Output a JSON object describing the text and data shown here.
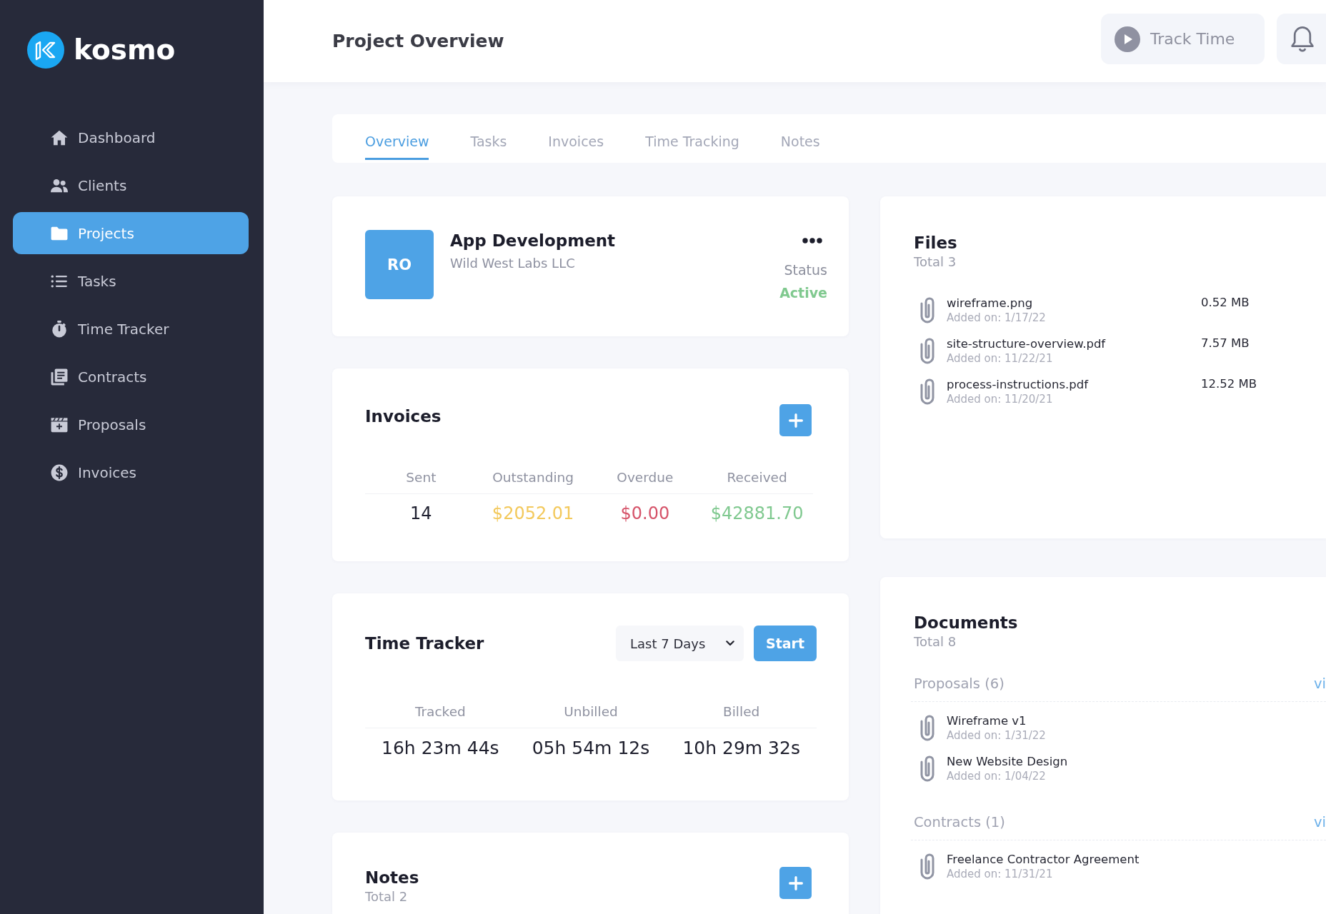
{
  "sidebar": {
    "brand": "kosmo",
    "items": [
      {
        "label": "Dashboard",
        "selected": false
      },
      {
        "label": "Clients",
        "selected": false
      },
      {
        "label": "Projects",
        "selected": true
      },
      {
        "label": "Tasks",
        "selected": false
      },
      {
        "label": "Time Tracker",
        "selected": false
      },
      {
        "label": "Contracts",
        "selected": false
      },
      {
        "label": "Proposals",
        "selected": false
      },
      {
        "label": "Invoices",
        "selected": false
      }
    ]
  },
  "header": {
    "title": "Project Overview",
    "track_button": "Track Time"
  },
  "tabs": [
    {
      "label": "Overview",
      "selected": true
    },
    {
      "label": "Tasks",
      "selected": false
    },
    {
      "label": "Invoices",
      "selected": false
    },
    {
      "label": "Time Tracking",
      "selected": false
    },
    {
      "label": "Notes",
      "selected": false
    }
  ],
  "project": {
    "initials": "RO",
    "name": "App Development",
    "client": "Wild West Labs LLC",
    "status_label": "Status",
    "status": "Active"
  },
  "invoices": {
    "title": "Invoices",
    "stats": [
      {
        "label": "Sent",
        "value": "14",
        "color": "#1f2030"
      },
      {
        "label": "Outstanding",
        "value": "$2052.01",
        "color": "#f3c95c"
      },
      {
        "label": "Overdue",
        "value": "$0.00",
        "color": "#d6546a"
      },
      {
        "label": "Received",
        "value": "$42881.70",
        "color": "#80c990"
      }
    ]
  },
  "time_tracker": {
    "title": "Time Tracker",
    "range": "Last 7 Days",
    "start_button": "Start",
    "stats": [
      {
        "label": "Tracked",
        "value": "16h 23m 44s"
      },
      {
        "label": "Unbilled",
        "value": "05h 54m 12s"
      },
      {
        "label": "Billed",
        "value": "10h 29m 32s"
      }
    ]
  },
  "notes": {
    "title": "Notes",
    "total": "Total 2"
  },
  "files": {
    "title": "Files",
    "total": "Total 3",
    "items": [
      {
        "name": "wireframe.png",
        "added": "Added on: 1/17/22",
        "size": "0.52 MB"
      },
      {
        "name": "site-structure-overview.pdf",
        "added": "Added on: 11/22/21",
        "size": "7.57 MB"
      },
      {
        "name": "process-instructions.pdf",
        "added": "Added on: 11/20/21",
        "size": "12.52 MB"
      }
    ]
  },
  "documents": {
    "title": "Documents",
    "total": "Total 8",
    "groups": [
      {
        "title": "Proposals (6)",
        "link": "vi",
        "items": [
          {
            "name": "Wireframe v1",
            "added": "Added on: 1/31/22"
          },
          {
            "name": "New Website Design",
            "added": "Added on: 1/04/22"
          }
        ]
      },
      {
        "title": "Contracts (1)",
        "link": "vi",
        "items": [
          {
            "name": "Freelance Contractor Agreement",
            "added": "Added on: 11/31/21"
          }
        ]
      }
    ]
  }
}
